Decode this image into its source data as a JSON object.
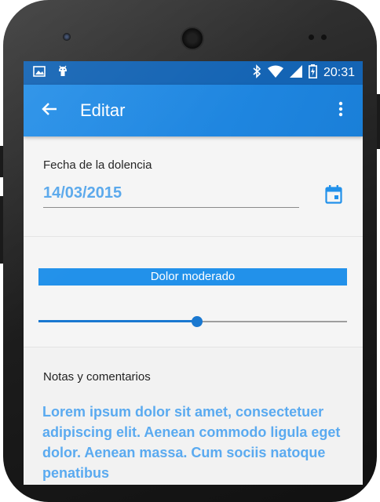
{
  "status_bar": {
    "time": "20:31",
    "left_icons": [
      "image-icon",
      "android-icon"
    ],
    "right_icons": [
      "bluetooth-icon",
      "wifi-icon",
      "signal-icon",
      "battery-charging-icon"
    ]
  },
  "app_bar": {
    "title": "Editar",
    "back_icon": "arrow-back-icon",
    "menu_icon": "more-vert-icon",
    "color": "#2188e5"
  },
  "date_section": {
    "label": "Fecha de la dolencia",
    "value": "14/03/2015",
    "calendar_icon": "calendar-icon"
  },
  "pain_section": {
    "level_label": "Dolor moderado",
    "slider_value": 0.515
  },
  "notes_section": {
    "label": "Notas y comentarios",
    "text": "Lorem ipsum dolor sit amet, consectetuer adipiscing elit. Aenean commodo ligula eget dolor. Aenean massa. Cum sociis natoque penatibus"
  },
  "colors": {
    "accent": "#2291ea",
    "status_bar": "#1464b4",
    "value_text": "#59a8ec"
  }
}
